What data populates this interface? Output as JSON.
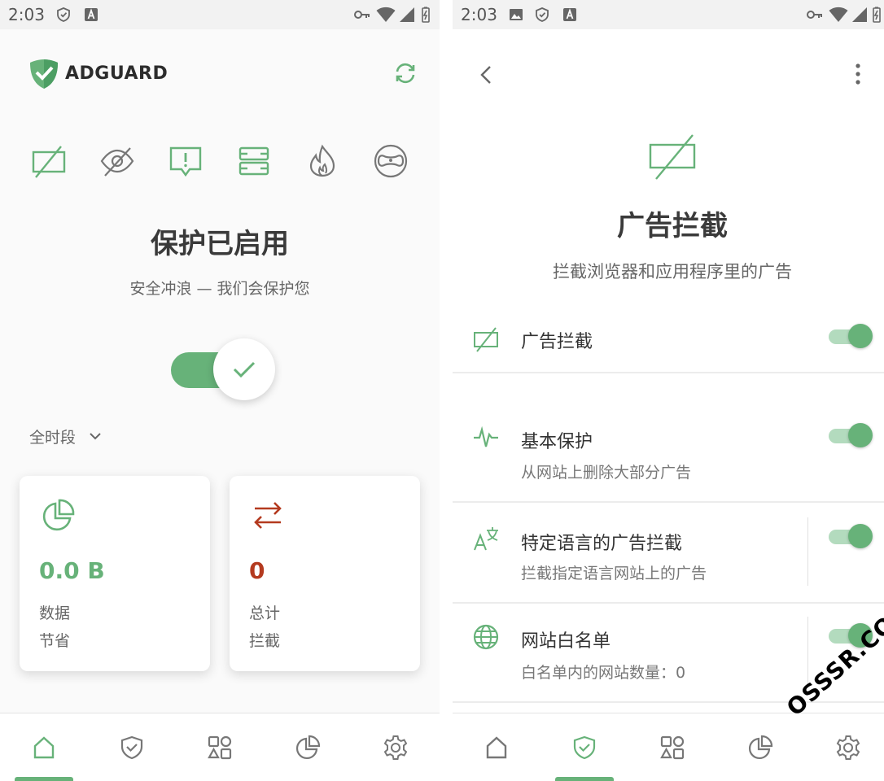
{
  "status_bar_left": {
    "time": "2:03"
  },
  "status_bar_right": {
    "time": "2:03"
  },
  "home": {
    "brand": "ADGUARD",
    "title": "保护已启用",
    "subtitle": "安全冲浪 — 我们会保护您",
    "protection_enabled": true,
    "period": "全时段",
    "feature_icons": [
      "ad-blocking-icon",
      "tracking-protection-icon",
      "annoyance-icon",
      "dns-icon",
      "firewall-icon",
      "stealth-mode-icon"
    ],
    "cards": [
      {
        "value": "0.0 B",
        "line1": "数据",
        "line2": "节省",
        "color": "#67b279",
        "icon": "pie-chart-icon"
      },
      {
        "value": "0",
        "line1": "总计",
        "line2": "拦截",
        "color": "#b43a1f",
        "icon": "transfer-arrows-icon"
      }
    ],
    "nav": [
      "home-icon",
      "shield-icon",
      "apps-icon",
      "stats-icon",
      "settings-icon"
    ],
    "active_nav": "home-icon"
  },
  "ad_blocking": {
    "title": "广告拦截",
    "subtitle": "拦截浏览器和应用程序里的广告",
    "rows": [
      {
        "title": "广告拦截",
        "subtitle": "",
        "enabled": true,
        "icon": "ad-blocking-icon"
      },
      {
        "title": "基本保护",
        "subtitle": "从网站上删除大部分广告",
        "enabled": true,
        "icon": "pulse-icon"
      },
      {
        "title": "特定语言的广告拦截",
        "subtitle": "拦截指定语言网站上的广告",
        "enabled": true,
        "icon": "translate-icon"
      },
      {
        "title": "网站白名单",
        "subtitle": "白名单内的网站数量：0",
        "enabled": true,
        "icon": "globe-icon"
      }
    ],
    "nav": [
      "home-icon",
      "shield-icon",
      "apps-icon",
      "stats-icon",
      "settings-icon"
    ],
    "active_nav": "shield-icon"
  },
  "watermark": "OSSSR.COM",
  "colors": {
    "accent": "#67b279",
    "accent_light": "#b3dbbe",
    "danger": "#b43a1f"
  }
}
